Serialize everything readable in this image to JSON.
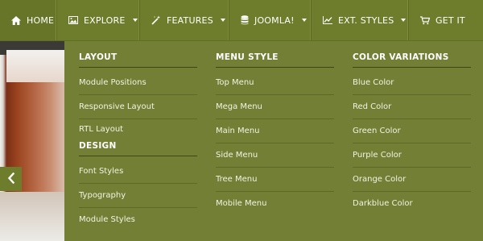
{
  "navbar": {
    "items": [
      {
        "label": "HOME",
        "icon": "home-icon",
        "has_dropdown": false
      },
      {
        "label": "EXPLORE",
        "icon": "image-icon",
        "has_dropdown": true
      },
      {
        "label": "FEATURES",
        "icon": "magic-wand-icon",
        "has_dropdown": true
      },
      {
        "label": "JOOMLA!",
        "icon": "database-icon",
        "has_dropdown": true
      },
      {
        "label": "EXT. STYLES",
        "icon": "chart-line-icon",
        "has_dropdown": true
      },
      {
        "label": "GET IT",
        "icon": "cart-icon",
        "has_dropdown": false
      }
    ]
  },
  "mega_menu": {
    "layout": {
      "title": "LAYOUT",
      "links": [
        "Module Positions",
        "Responsive Layout",
        "RTL Layout"
      ]
    },
    "design": {
      "title": "DESIGN",
      "links": [
        "Font Styles",
        "Typography",
        "Module Styles"
      ]
    },
    "menu_style": {
      "title": "MENU STYLE",
      "links": [
        "Top Menu",
        "Mega Menu",
        "Main Menu",
        "Side Menu",
        "Tree Menu",
        "Mobile Menu"
      ]
    },
    "color_variations": {
      "title": "COLOR VARIATIONS",
      "links": [
        "Blue Color",
        "Red Color",
        "Green Color",
        "Purple Color",
        "Orange Color",
        "Darkblue Color"
      ]
    }
  },
  "slider": {
    "prev_icon": "chevron-left-icon"
  },
  "colors": {
    "navbar": "#6d7d2c",
    "menu_panel": "#737f35",
    "text": "#ffffff"
  }
}
